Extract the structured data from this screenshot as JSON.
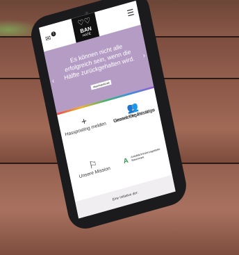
{
  "header": {
    "logo_title": "BAN",
    "logo_subtitle": "HATE",
    "badge_count": "1"
  },
  "hero": {
    "message": "Es können nicht alle erfolgreich sein, wenn die Hälfte zurückgehalten wird.",
    "tag": "#banhatefürall"
  },
  "tiles": [
    {
      "label": "Gemeldete Postings",
      "icon": "document-icon"
    },
    {
      "label": "Hassposting melden",
      "icon": "plus-icon"
    },
    {
      "label": "Unsere Organisation",
      "icon": "people-icon"
    },
    {
      "label": "Unsere Mission",
      "icon": "flag-icon"
    }
  ],
  "partner": {
    "name": "Antidiskriminierungsstelle Steiermark"
  },
  "footer": {
    "text": "Eine Initiative der:"
  }
}
